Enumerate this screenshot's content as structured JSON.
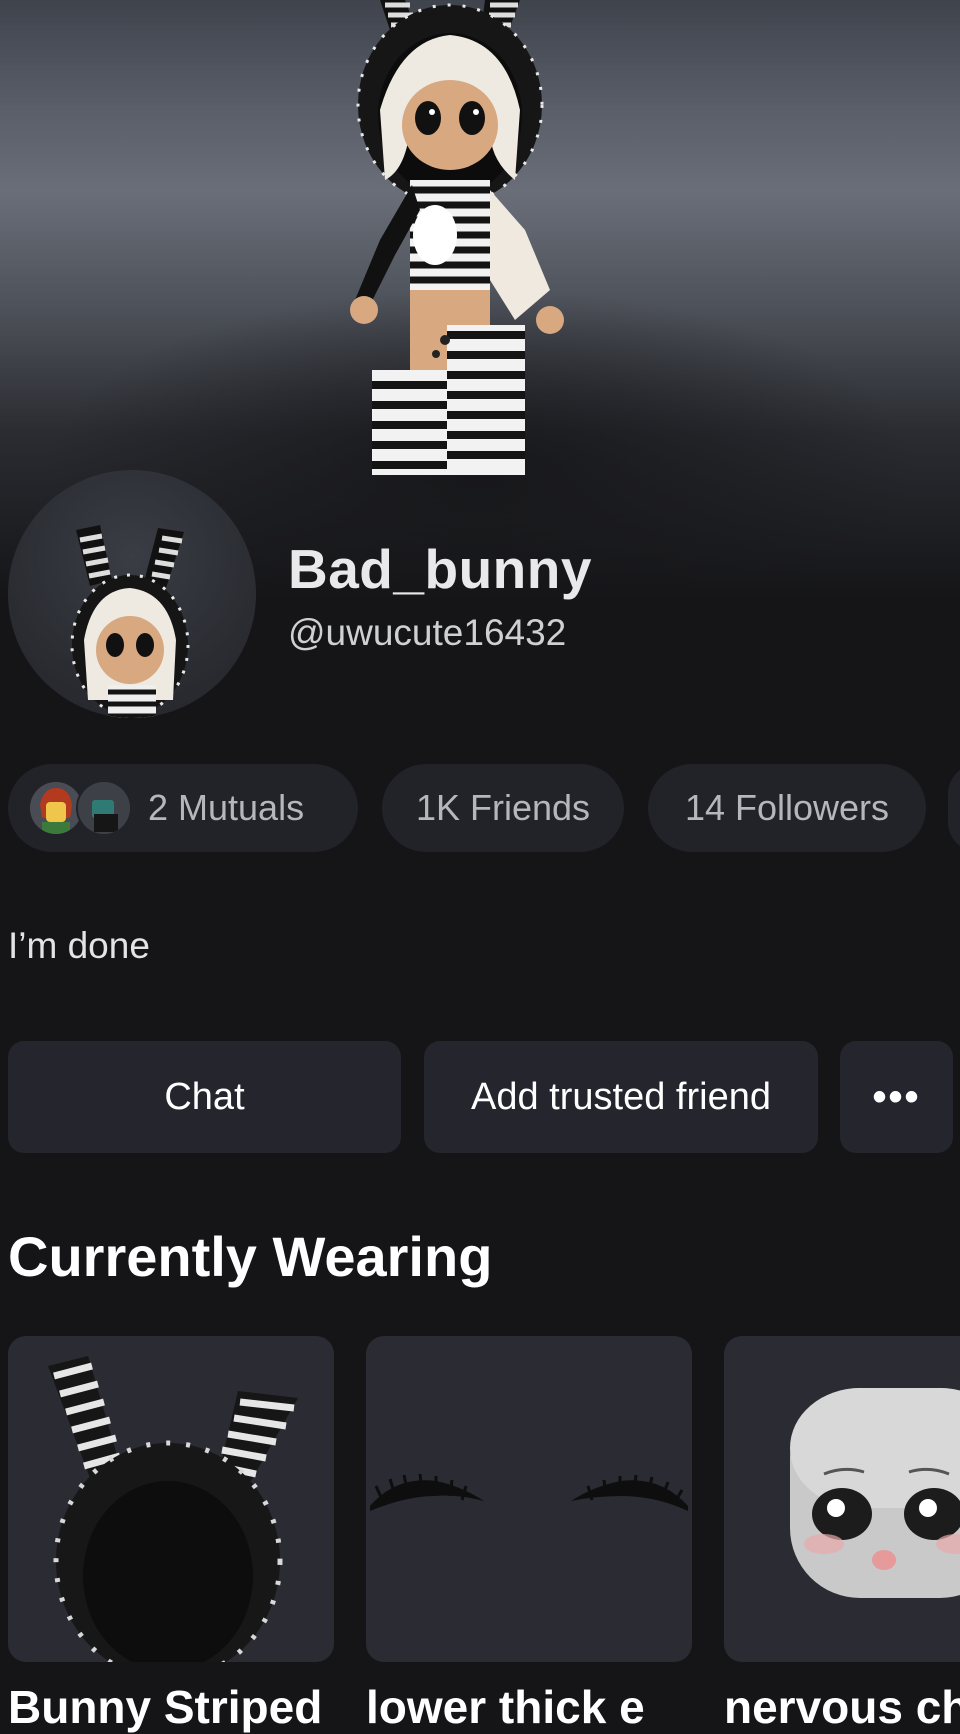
{
  "profile": {
    "display_name": "Bad_bunny",
    "username": "@uwucute16432"
  },
  "stats": {
    "mutuals": "2 Mutuals",
    "friends": "1K Friends",
    "followers": "14 Followers"
  },
  "bio": "I’m done",
  "actions": {
    "chat": "Chat",
    "add_trusted": "Add trusted friend",
    "more": "•••"
  },
  "wearing": {
    "title": "Currently Wearing",
    "items": [
      {
        "name": "Bunny Striped"
      },
      {
        "name": "lower thick e"
      },
      {
        "name": "nervous ch"
      }
    ]
  },
  "colors": {
    "background": "#151518",
    "card": "#25262d",
    "pill": "#222329",
    "text_primary": "#ffffff",
    "text_secondary": "#b6b7bd"
  },
  "icons": {
    "more": "ellipsis-icon"
  }
}
